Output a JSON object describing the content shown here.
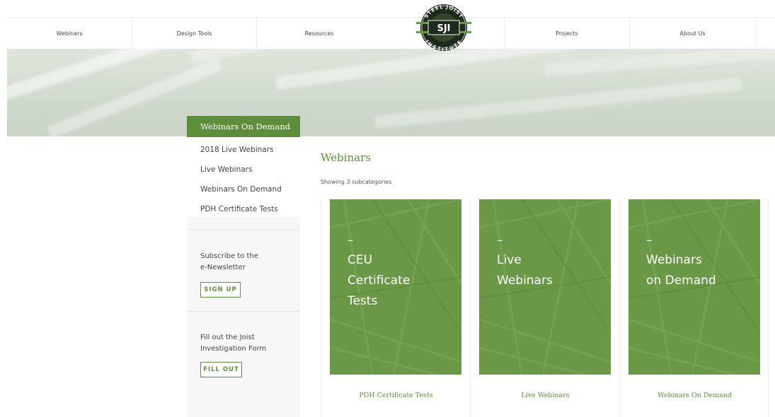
{
  "nav": {
    "items_left": [
      "Webinars",
      "Design Tools",
      "Resources"
    ],
    "items_right": [
      "Projects",
      "About Us"
    ]
  },
  "logo": {
    "top_text": "STEEL JOIST",
    "center_text": "SJI",
    "bottom_text": "INSTITUTE"
  },
  "sidebar": {
    "active_tab": "Webinars On Demand",
    "links": [
      "2018 Live Webinars",
      "Live Webinars",
      "Webinars On Demand",
      "PDH Certificate Tests"
    ],
    "newsletter": {
      "line1": "Subscribe to the",
      "line2": "e-Newsletter",
      "button": "SIGN UP"
    },
    "investigation": {
      "line1": "Fill out the Joist",
      "line2": "Investigation Form",
      "button": "FILL OUT"
    }
  },
  "main": {
    "title": "Webinars",
    "subtitle": "Showing 3 subcategories",
    "cards": [
      {
        "dash": "–",
        "lines": [
          "CEU",
          "Certificate",
          "Tests"
        ],
        "link": "PDH Certificate Tests"
      },
      {
        "dash": "–",
        "lines": [
          "Live",
          "Webinars"
        ],
        "link": "Live Webinars"
      },
      {
        "dash": "–",
        "lines": [
          "Webinars",
          "on Demand"
        ],
        "link": "Webinars On Demand"
      }
    ]
  },
  "colors": {
    "brand_green": "#5e8d3b",
    "card_green": "#6a9847"
  }
}
